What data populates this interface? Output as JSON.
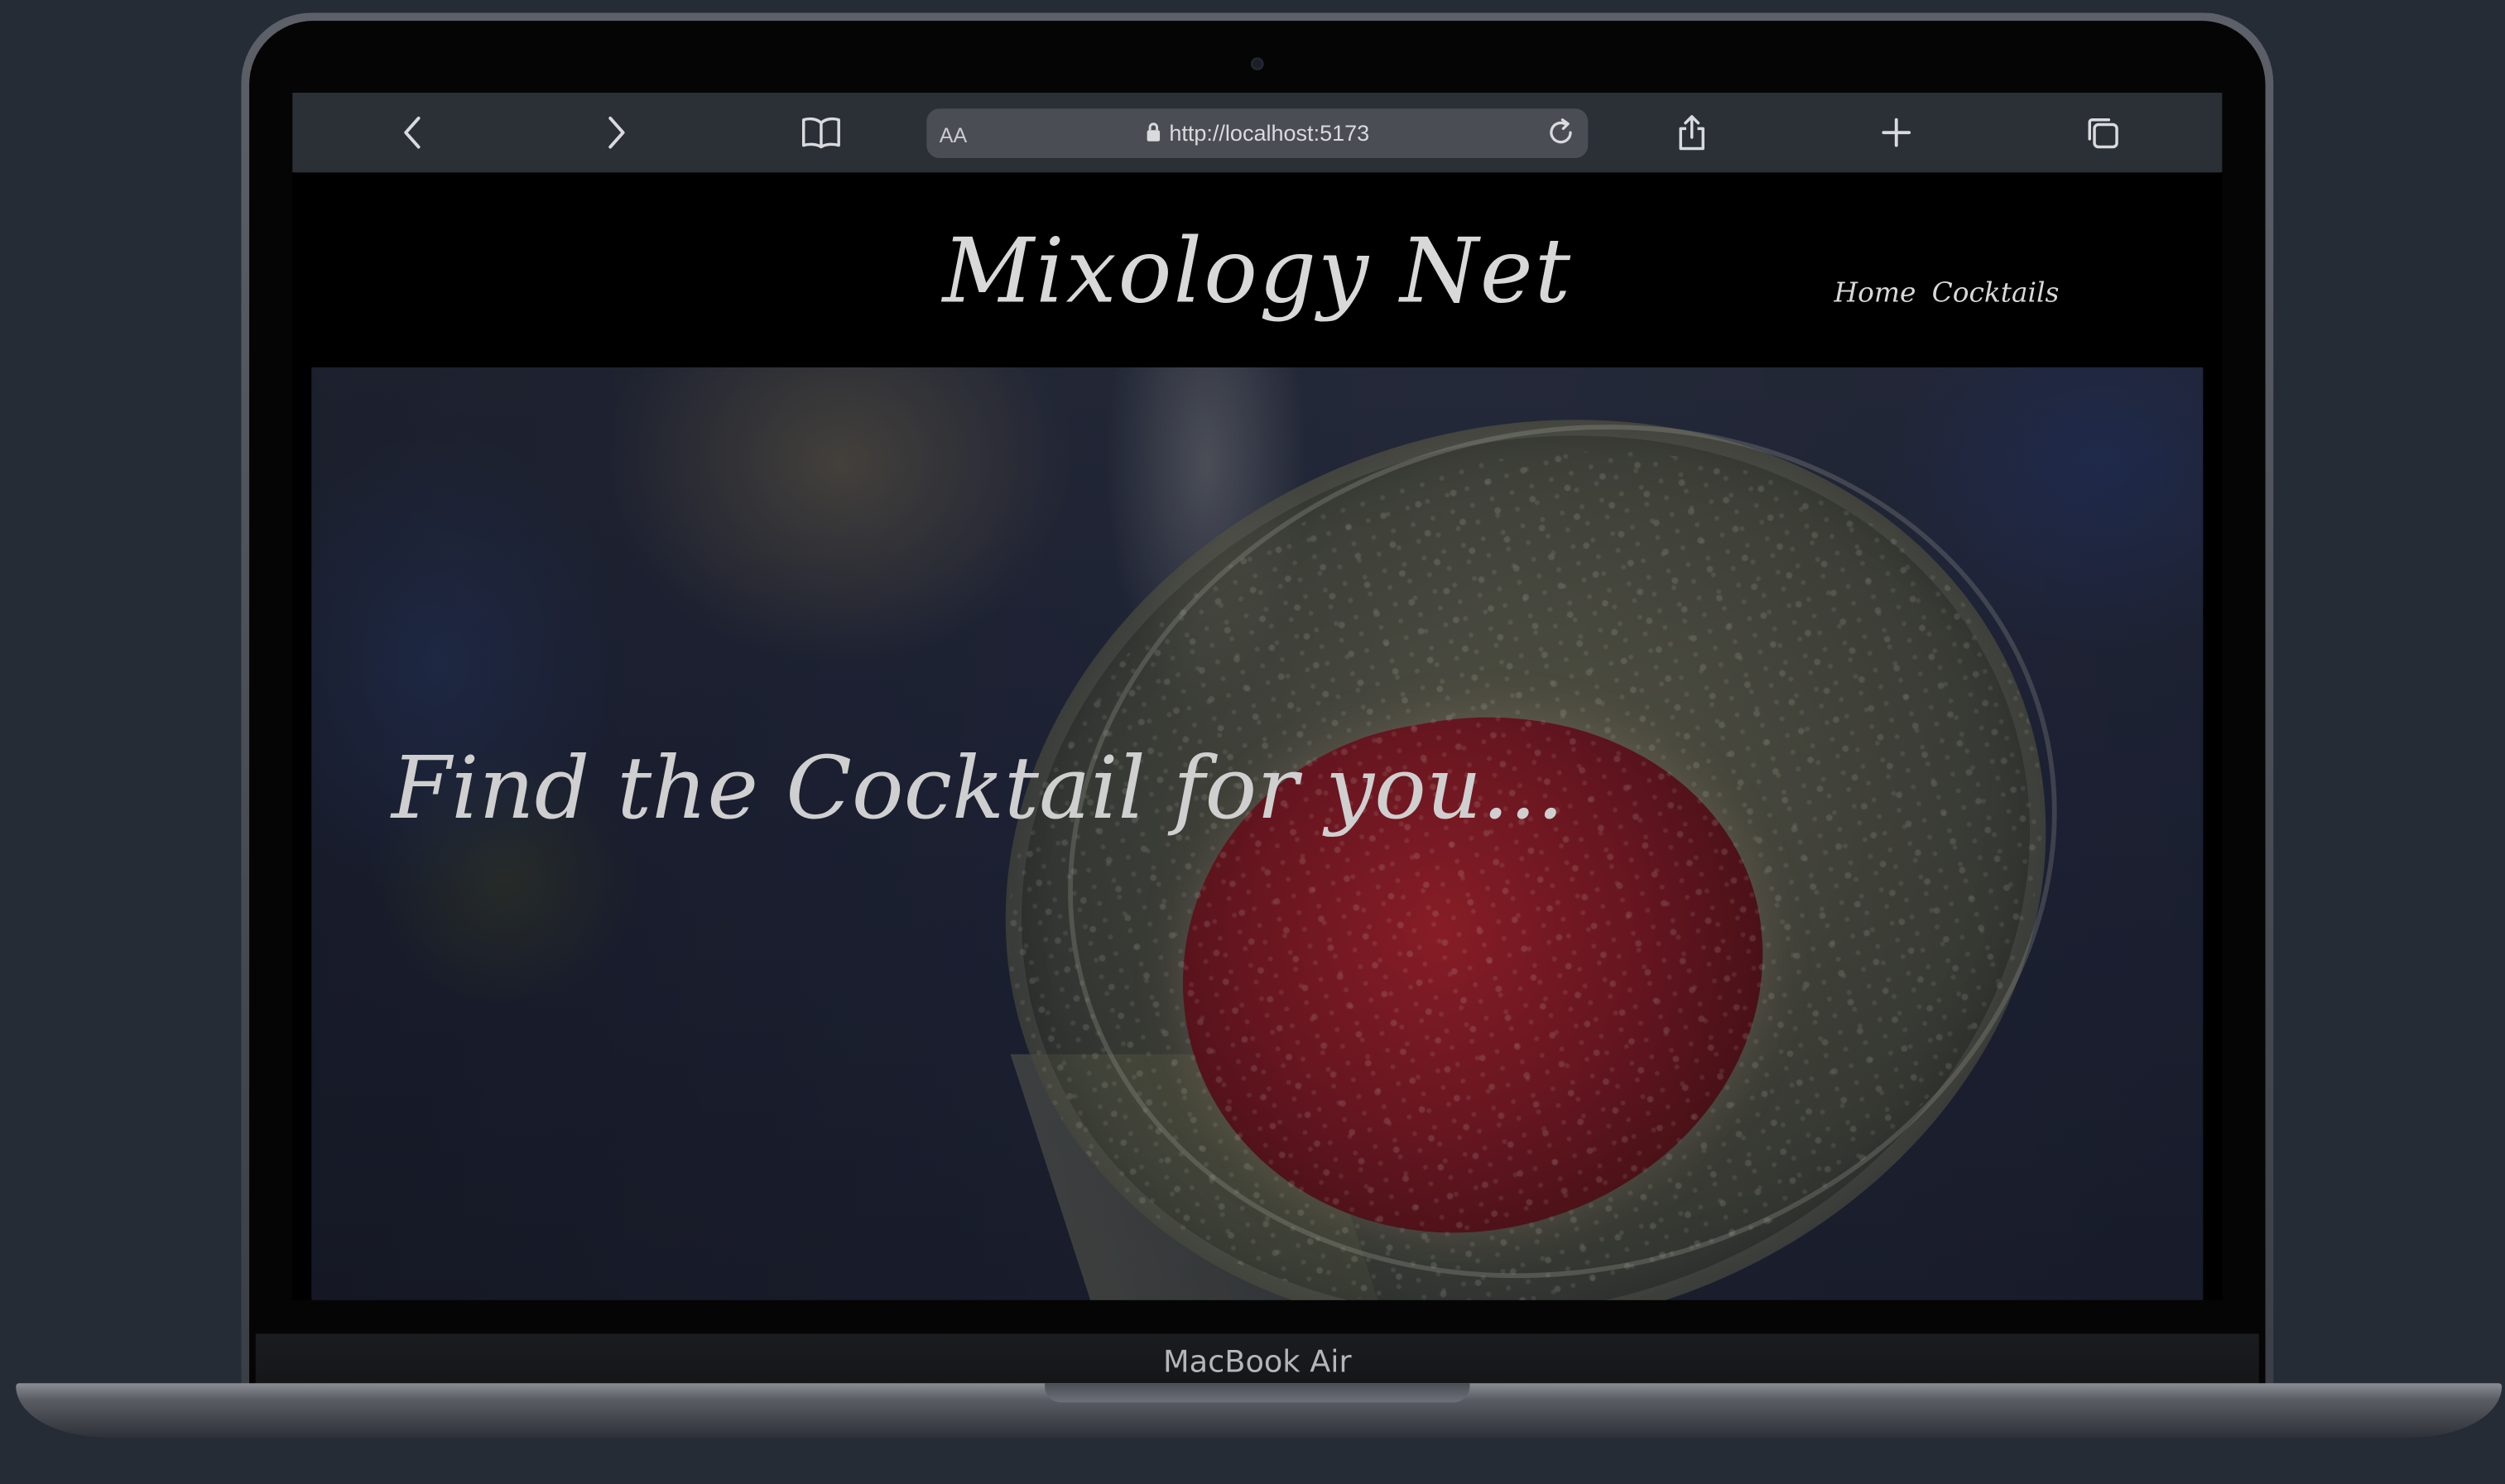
{
  "browser": {
    "url": "http://localhost:5173",
    "reader_label": "AA"
  },
  "site": {
    "brand": "Mixology Net",
    "nav": [
      {
        "label": "Home"
      },
      {
        "label": "Cocktails"
      }
    ],
    "hero_title": "Find the Cocktail for you..."
  },
  "device": {
    "model_label": "MacBook Air"
  },
  "icons": {
    "back": "chevron-left",
    "forward": "chevron-right",
    "bookmarks": "open-book",
    "lock": "padlock",
    "reload": "circular-arrow",
    "share": "share-box-arrow",
    "new_tab": "plus",
    "tabs": "overlapping-squares"
  },
  "colors": {
    "background": "#262c36",
    "toolbar": "#2b2f36",
    "urlbar": "#4a4d54",
    "page": "#000000",
    "text": "#d8d8d8"
  }
}
